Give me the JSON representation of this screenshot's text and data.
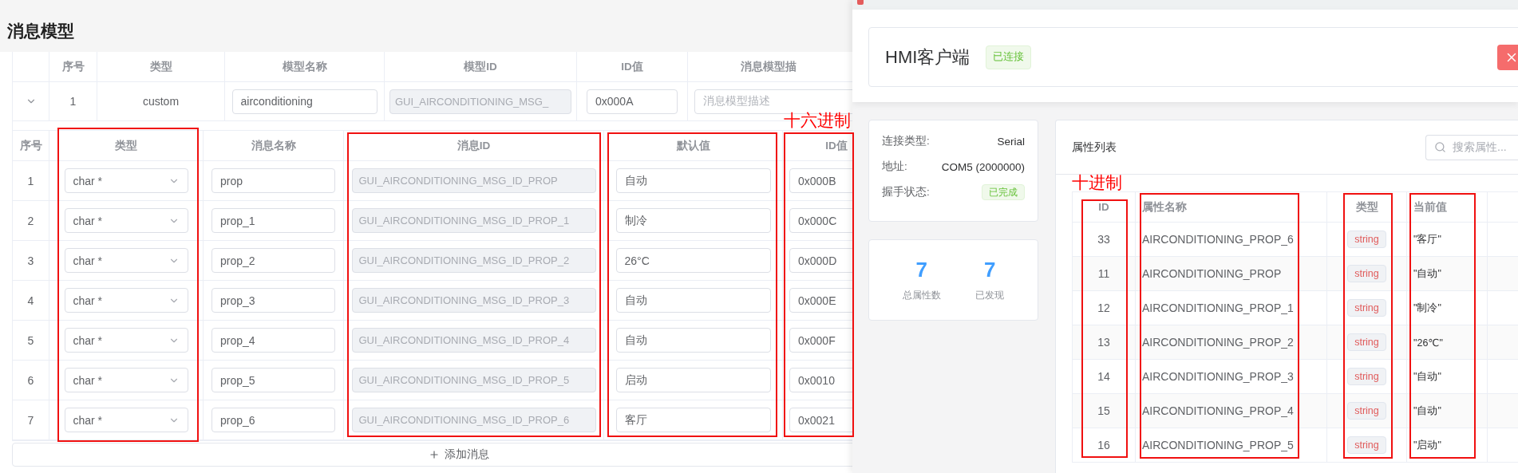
{
  "left_page": {
    "title": "消息模型",
    "model_table": {
      "columns": [
        "序号",
        "类型",
        "模型名称",
        "模型ID",
        "ID值",
        "消息模型描"
      ],
      "rows": [
        {
          "expanded": true,
          "index": "1",
          "type": "custom",
          "name": "airconditioning",
          "model_id": "GUI_AIRCONDITIONING_MSG_",
          "id_value": "0x000A",
          "description_placeholder": "消息模型描述"
        }
      ]
    },
    "message_table": {
      "columns": [
        "序号",
        "类型",
        "消息名称",
        "消息ID",
        "默认值",
        "ID值"
      ],
      "rows": [
        {
          "index": "1",
          "type": "char *",
          "name": "prop",
          "message_id": "GUI_AIRCONDITIONING_MSG_ID_PROP",
          "default_value": "自动",
          "id_value": "0x000B"
        },
        {
          "index": "2",
          "type": "char *",
          "name": "prop_1",
          "message_id": "GUI_AIRCONDITIONING_MSG_ID_PROP_1",
          "default_value": "制冷",
          "id_value": "0x000C"
        },
        {
          "index": "3",
          "type": "char *",
          "name": "prop_2",
          "message_id": "GUI_AIRCONDITIONING_MSG_ID_PROP_2",
          "default_value": "26°C",
          "id_value": "0x000D"
        },
        {
          "index": "4",
          "type": "char *",
          "name": "prop_3",
          "message_id": "GUI_AIRCONDITIONING_MSG_ID_PROP_3",
          "default_value": "自动",
          "id_value": "0x000E"
        },
        {
          "index": "5",
          "type": "char *",
          "name": "prop_4",
          "message_id": "GUI_AIRCONDITIONING_MSG_ID_PROP_4",
          "default_value": "自动",
          "id_value": "0x000F"
        },
        {
          "index": "6",
          "type": "char *",
          "name": "prop_5",
          "message_id": "GUI_AIRCONDITIONING_MSG_ID_PROP_5",
          "default_value": "启动",
          "id_value": "0x0010"
        },
        {
          "index": "7",
          "type": "char *",
          "name": "prop_6",
          "message_id": "GUI_AIRCONDITIONING_MSG_ID_PROP_6",
          "default_value": "客厅",
          "id_value": "0x0021"
        }
      ]
    },
    "add_button": "添加消息"
  },
  "client_window": {
    "title": "HMI客户端",
    "status_tag": "已连接",
    "info": [
      {
        "kind": "text",
        "label": "连接类型:",
        "value": "Serial"
      },
      {
        "kind": "text",
        "label": "地址:",
        "value": "COM5 (2000000)"
      },
      {
        "kind": "tag",
        "label": "握手状态:",
        "value": "已完成"
      }
    ],
    "stats": [
      {
        "value": "7",
        "label": "总属性数"
      },
      {
        "value": "7",
        "label": "已发现"
      }
    ],
    "property_list": {
      "title": "属性列表",
      "search": {
        "placeholder": "搜索属性..."
      },
      "columns": [
        "ID",
        "属性名称",
        "类型",
        "当前值"
      ],
      "rows": [
        {
          "id": "33",
          "name": "AIRCONDITIONING_PROP_6",
          "type": "string",
          "value": "\"客厅\""
        },
        {
          "id": "11",
          "name": "AIRCONDITIONING_PROP",
          "type": "string",
          "value": "\"自动\""
        },
        {
          "id": "12",
          "name": "AIRCONDITIONING_PROP_1",
          "type": "string",
          "value": "\"制冷\""
        },
        {
          "id": "13",
          "name": "AIRCONDITIONING_PROP_2",
          "type": "string",
          "value": "\"26℃\""
        },
        {
          "id": "14",
          "name": "AIRCONDITIONING_PROP_3",
          "type": "string",
          "value": "\"自动\""
        },
        {
          "id": "15",
          "name": "AIRCONDITIONING_PROP_4",
          "type": "string",
          "value": "\"自动\""
        },
        {
          "id": "16",
          "name": "AIRCONDITIONING_PROP_5",
          "type": "string",
          "value": "\"启动\""
        }
      ]
    }
  },
  "annotations": [
    {
      "text": "十六进制"
    },
    {
      "text": "十进制"
    }
  ]
}
